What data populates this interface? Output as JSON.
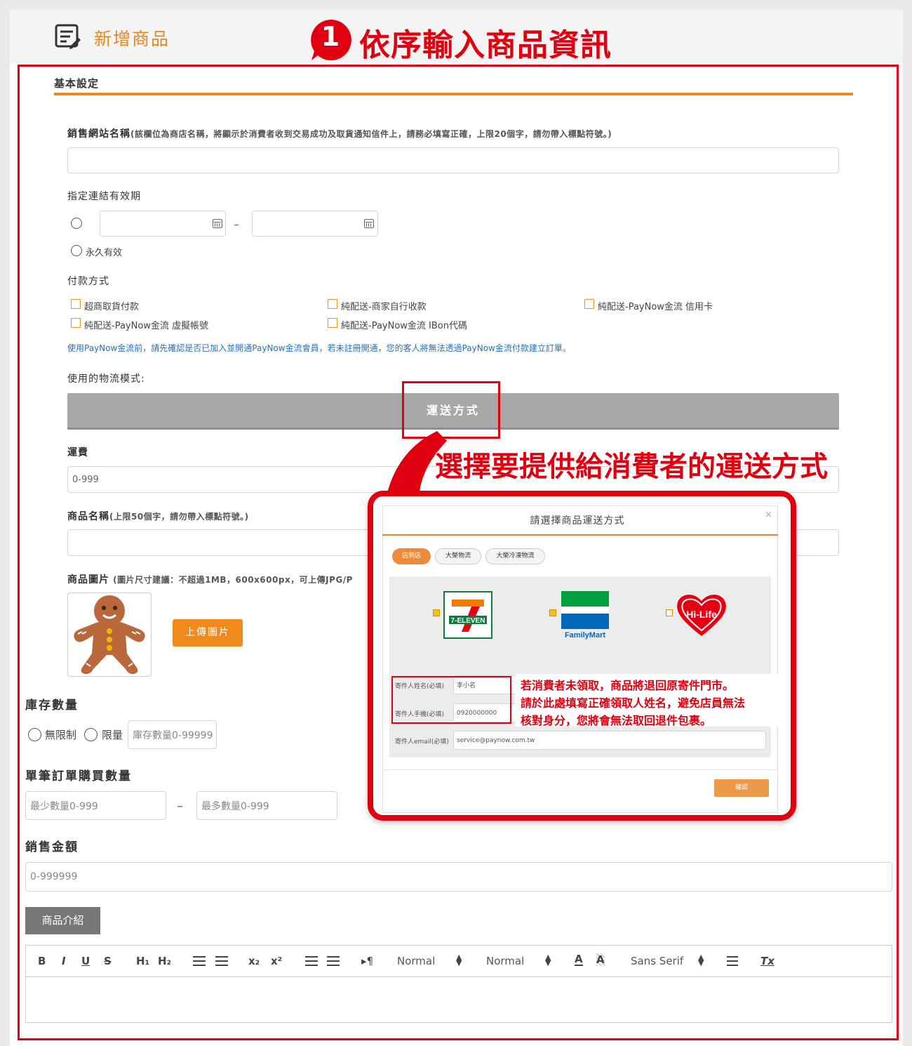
{
  "header": {
    "title": "新增商品",
    "step_number": "1",
    "step_title": "依序輸入商品資訊"
  },
  "section": {
    "title": "基本設定"
  },
  "site_name": {
    "label": "銷售網站名稱",
    "hint": "(該欄位為商店名稱，將顯示於消費者收到交易成功及取貨通知信件上，請務必填寫正確，上限20個字，請勿帶入標點符號。)",
    "value": ""
  },
  "validity": {
    "label": "指定連結有效期",
    "dash": "–",
    "forever": "永久有效"
  },
  "payment": {
    "label": "付款方式",
    "options": [
      "超商取貨付款",
      "純配送-商家自行收款",
      "純配送-PayNow金流 信用卡",
      "純配送-PayNow金流 虛擬帳號",
      "純配送-PayNow金流 IBon代碼"
    ],
    "note": "使用PayNow金流前，請先確認是否已加入並開通PayNow金流會員，若未註冊開通，您的客人將無法透過PayNow金流付款建立訂單。"
  },
  "logistics": {
    "label": "使用的物流模式:",
    "button": "運送方式"
  },
  "shipping_fee": {
    "label": "運費",
    "placeholder": "0-999"
  },
  "product_name": {
    "label": "商品名稱",
    "hint": "(上限50個字，請勿帶入標點符號。)"
  },
  "product_image": {
    "label": "商品圖片",
    "hint": "(圖片尺寸建議：不超過1MB，600x600px，可上傳JPG/P",
    "upload": "上傳圖片"
  },
  "stock": {
    "label": "庫存數量",
    "unlimited": "無限制",
    "limited": "限量",
    "placeholder": "庫存數量0-99999"
  },
  "order_qty": {
    "label": "單筆訂單購買數量",
    "min_placeholder": "最少數量0-999",
    "dash": "–",
    "max_placeholder": "最多數量0-999"
  },
  "price": {
    "label": "銷售金額",
    "placeholder": "0-999999"
  },
  "intro": {
    "tab": "商品介紹",
    "toolbar": {
      "bold": "B",
      "italic": "I",
      "underline": "U",
      "strike": "S",
      "h1": "H₁",
      "h2": "H₂",
      "sub": "x₂",
      "sup": "x²",
      "size1": "Normal",
      "size2": "Normal",
      "font": "Sans Serif",
      "clear": "Tx"
    }
  },
  "callout": {
    "title": "選擇要提供給消費者的運送方式"
  },
  "modal": {
    "title": "請選擇商品運送方式",
    "close": "×",
    "tabs": [
      "店到店",
      "大榮物流",
      "大榮冷凍物流"
    ],
    "stores": [
      "7-ELEVEN",
      "FamilyMart",
      "Hi-Life"
    ],
    "sender_name_label": "寄件人姓名(必填)",
    "sender_name_value": "李小名",
    "sender_phone_label": "寄件人手機(必填)",
    "sender_phone_value": "0920000000",
    "sender_email_label": "寄件人email(必填)",
    "sender_email_value": "service@paynow.com.tw",
    "confirm": "確認",
    "warning": [
      "若消費者未領取，商品將退回原寄件門市。",
      "請於此處填寫正確領取人姓名，避免店員無法",
      "核對身分，您將會無法取回退件包裹。"
    ]
  },
  "colors": {
    "accent": "#e8871e",
    "annotation": "#e1000f",
    "orange_button": "#f08a1c",
    "link_blue": "#2a6fb5"
  }
}
